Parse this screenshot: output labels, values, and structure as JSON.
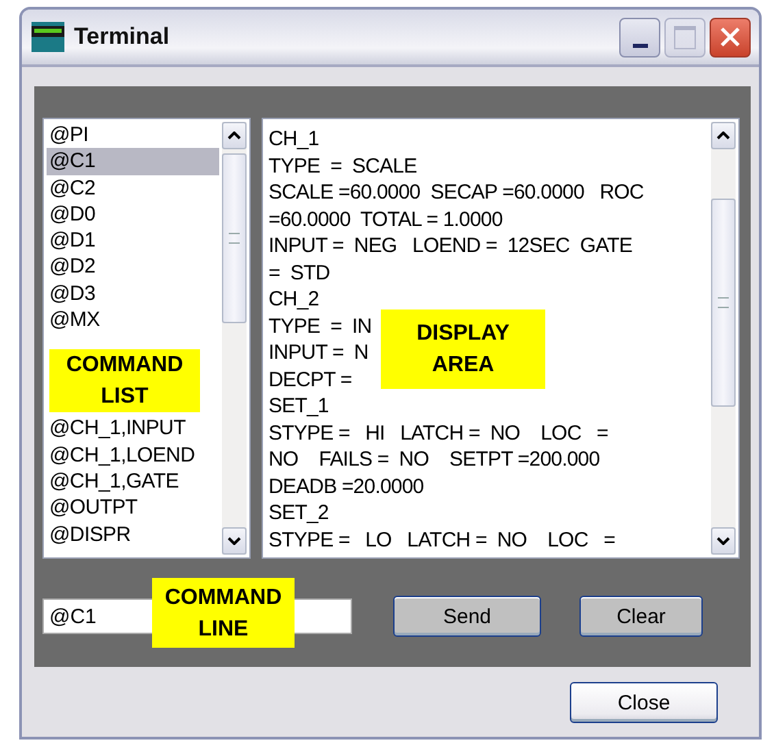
{
  "window": {
    "title": "Terminal"
  },
  "command_list": {
    "callout": "COMMAND LIST",
    "items": [
      {
        "label": "@PI",
        "selected": false
      },
      {
        "label": "@C1",
        "selected": true
      },
      {
        "label": "@C2",
        "selected": false
      },
      {
        "label": "@D0",
        "selected": false
      },
      {
        "label": "@D1",
        "selected": false
      },
      {
        "label": "@D2",
        "selected": false
      },
      {
        "label": "@D3",
        "selected": false
      },
      {
        "label": "@MX",
        "selected": false
      },
      {
        "label": "@CH_1,INPUT",
        "selected": false
      },
      {
        "label": "@CH_1,LOEND",
        "selected": false
      },
      {
        "label": "@CH_1,GATE",
        "selected": false
      },
      {
        "label": "@OUTPT",
        "selected": false
      },
      {
        "label": "@DISPR",
        "selected": false
      }
    ]
  },
  "display_area": {
    "callout": "DISPLAY AREA",
    "lines": [
      "CH_1",
      "TYPE  =  SCALE",
      "SCALE =60.0000  SECAP =60.0000   ROC",
      "=60.0000  TOTAL = 1.0000",
      "INPUT =  NEG   LOEND =  12SEC  GATE",
      "=  STD",
      "CH_2",
      "TYPE  =  IN",
      "INPUT =  N",
      "DECPT =",
      "SET_1",
      "STYPE =   HI   LATCH =  NO    LOC   =",
      "NO    FAILS =  NO    SETPT =200.000",
      "DEADB =20.0000",
      "SET_2",
      "STYPE =   LO   LATCH =  NO    LOC   ="
    ]
  },
  "command_line": {
    "value": "@C1",
    "callout": "COMMAND LINE"
  },
  "buttons": {
    "send": "Send",
    "clear": "Clear",
    "close": "Close"
  }
}
